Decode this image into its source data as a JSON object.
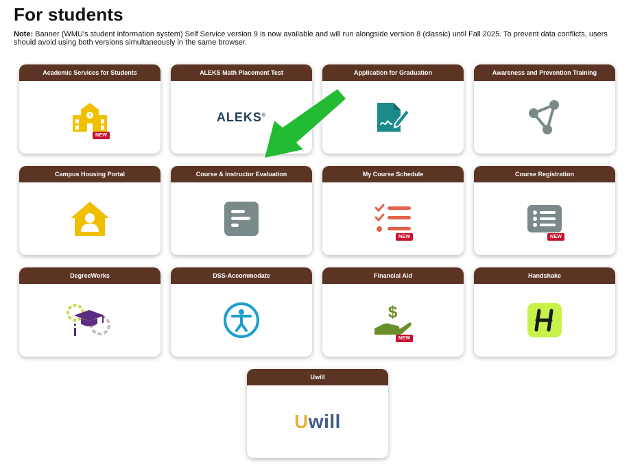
{
  "page": {
    "title": "For students",
    "note_label": "Note:",
    "note_text": " Banner (WMU's student information system) Self Service version 9 is now available and will run alongside version 8 (classic) until Fall 2025. To prevent data conflicts, users should avoid using both versions simultaneously in the same browser."
  },
  "badge_label": "NEW",
  "colors": {
    "header_bg": "#5c3424",
    "badge": "#c8102e",
    "arrow": "#22bb33",
    "icon_gray": "#7a8a8a",
    "icon_yellow": "#f0c000",
    "icon_teal": "#1a8a8a",
    "icon_orange": "#e0634a"
  },
  "cards": [
    {
      "label": "Academic Services for Students",
      "icon": "school-building-icon",
      "new": true
    },
    {
      "label": "ALEKS Math Placement Test",
      "icon": "aleks-logo",
      "logo_text": "ALEKS",
      "new": false
    },
    {
      "label": "Application for Graduation",
      "icon": "document-signature-icon",
      "new": false
    },
    {
      "label": "Awareness and Prevention Training",
      "icon": "network-nodes-icon",
      "new": false
    },
    {
      "label": "Campus Housing Portal",
      "icon": "house-user-icon",
      "new": false
    },
    {
      "label": "Course & Instructor Evaluation",
      "icon": "evaluation-bars-icon",
      "new": false
    },
    {
      "label": "My Course Schedule",
      "icon": "checklist-icon",
      "new": true
    },
    {
      "label": "Course Registration",
      "icon": "list-icon",
      "new": true
    },
    {
      "label": "DegreeWorks",
      "icon": "graduation-gears-icon",
      "new": false
    },
    {
      "label": "DSS-Accommodate",
      "icon": "accessibility-icon",
      "new": false
    },
    {
      "label": "Financial Aid",
      "icon": "hand-dollar-icon",
      "new": true
    },
    {
      "label": "Handshake",
      "icon": "handshake-logo",
      "new": false
    },
    {
      "label": "Uwill",
      "icon": "uwill-logo",
      "logo_text": "Uwill",
      "new": false
    }
  ]
}
